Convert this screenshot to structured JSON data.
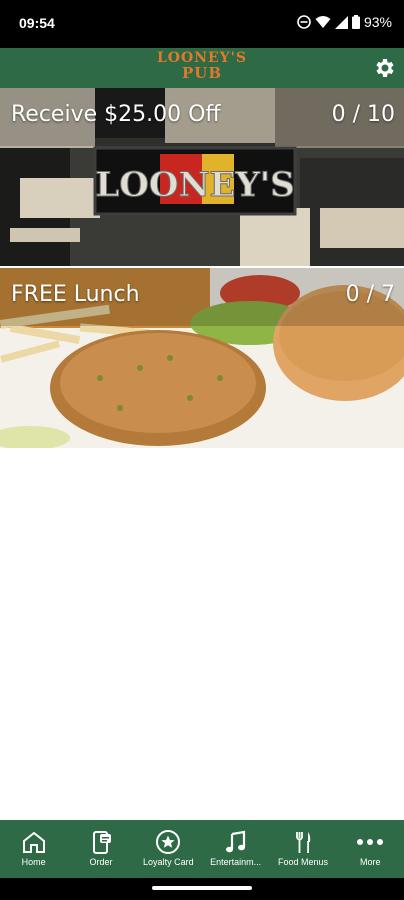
{
  "status_bar": {
    "time": "09:54",
    "battery": "93%",
    "icons": [
      "do-not-disturb-icon",
      "wifi-icon",
      "signal-icon",
      "battery-icon"
    ]
  },
  "header": {
    "logo_line1": "LOONEY'S",
    "logo_line2": "PUB",
    "settings_icon": "gear-icon",
    "colors": {
      "background": "#2d6a45",
      "logo": "#e07a2a"
    }
  },
  "rewards": [
    {
      "title": "Receive $25.00 Off",
      "progress": "0 / 10",
      "sign_text": "LOONEY'S"
    },
    {
      "title": "FREE Lunch",
      "progress": "0 / 7"
    }
  ],
  "bottom_nav": {
    "items": [
      {
        "label": "Home",
        "icon": "home-icon"
      },
      {
        "label": "Order",
        "icon": "order-icon"
      },
      {
        "label": "Loyalty Card",
        "icon": "star-icon"
      },
      {
        "label": "Entertainm...",
        "icon": "music-note-icon"
      },
      {
        "label": "Food Menus",
        "icon": "fork-knife-icon"
      },
      {
        "label": "More",
        "icon": "more-icon"
      }
    ]
  }
}
